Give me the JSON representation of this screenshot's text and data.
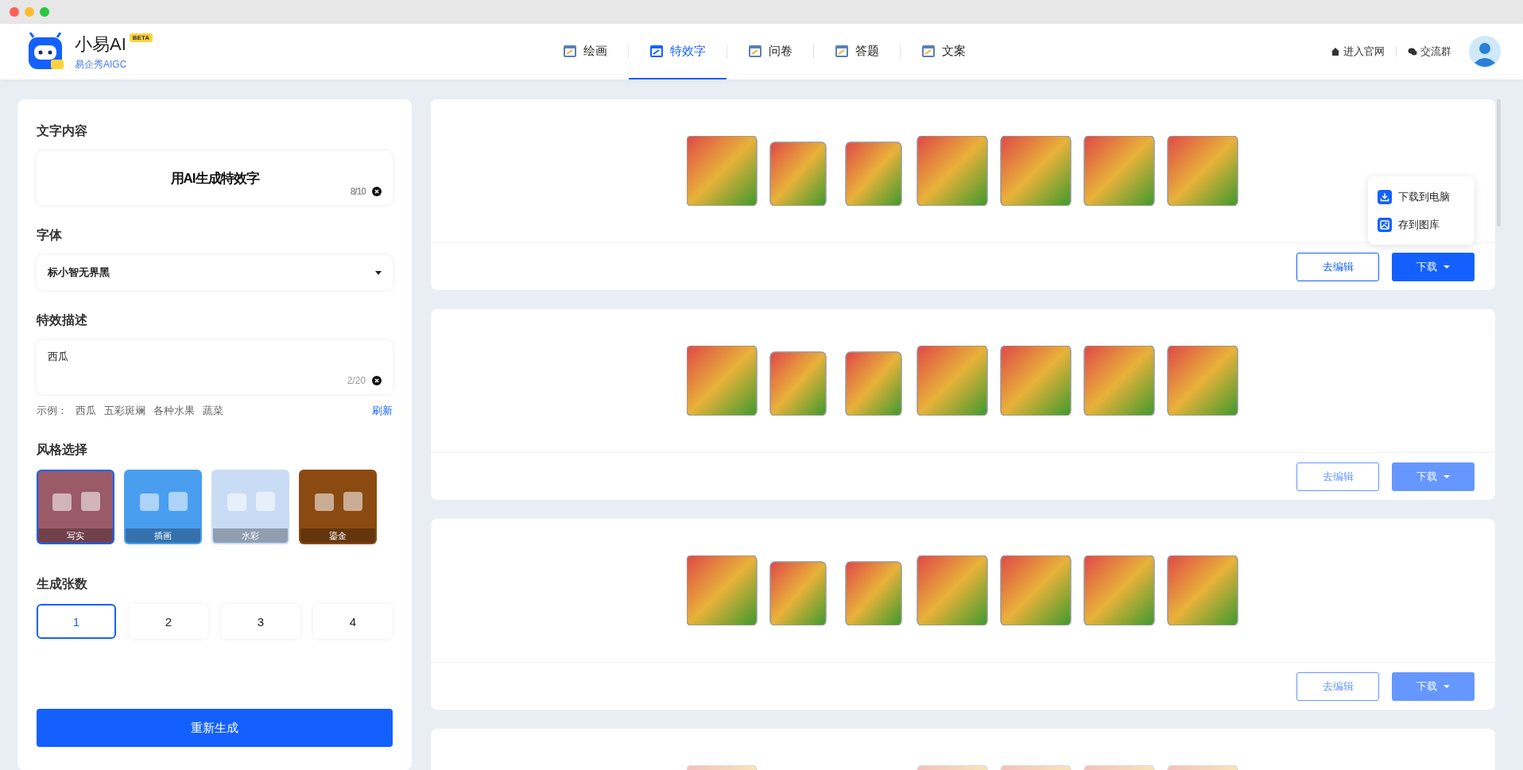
{
  "app": {
    "name": "小易AI",
    "badge": "BETA",
    "subtitle": "易企秀AIGC"
  },
  "nav_tabs": [
    {
      "label": "绘画",
      "selected": false
    },
    {
      "label": "特效字",
      "selected": true
    },
    {
      "label": "问卷",
      "selected": false
    },
    {
      "label": "答题",
      "selected": false
    },
    {
      "label": "文案",
      "selected": false
    }
  ],
  "header_links": [
    {
      "label": "进入官网",
      "kind": "home"
    },
    {
      "label": "交流群",
      "kind": "chat"
    }
  ],
  "panel": {
    "text_content": {
      "label": "文字内容",
      "value": "用AI生成特效字",
      "counter": "8/10"
    },
    "font": {
      "label": "字体",
      "value": "标小智无界黑"
    },
    "effect": {
      "label": "特效描述",
      "value": "西瓜",
      "counter": "2/20"
    },
    "examples": {
      "label": "示例：",
      "items": [
        "西瓜",
        "五彩斑斓",
        "各种水果",
        "蔬菜"
      ],
      "refresh": "刷新"
    },
    "styles": {
      "label": "风格选择",
      "items": [
        {
          "label": "写实",
          "selected": true,
          "color": "#9b5a68"
        },
        {
          "label": "插画",
          "selected": false,
          "color": "#4a9ef0"
        },
        {
          "label": "水彩",
          "selected": false,
          "color": "#c9dcf5"
        },
        {
          "label": "鎏金",
          "selected": false,
          "color": "#8a4a12"
        }
      ]
    },
    "count": {
      "label": "生成张数",
      "options": [
        {
          "label": "1",
          "selected": true
        },
        {
          "label": "2",
          "selected": false
        },
        {
          "label": "3",
          "selected": false
        },
        {
          "label": "4",
          "selected": false
        }
      ]
    },
    "submit": "重新生成"
  },
  "results": [
    {
      "active": true,
      "faded": false,
      "edit": "去编辑",
      "download": "下载",
      "menu": [
        {
          "label": "下载到电脑",
          "kind": "download"
        },
        {
          "label": "存到图库",
          "kind": "image"
        }
      ]
    },
    {
      "active": false,
      "faded": false,
      "edit": "去编辑",
      "download": "下载"
    },
    {
      "active": false,
      "faded": false,
      "edit": "去编辑",
      "download": "下载"
    },
    {
      "faded": true
    }
  ]
}
